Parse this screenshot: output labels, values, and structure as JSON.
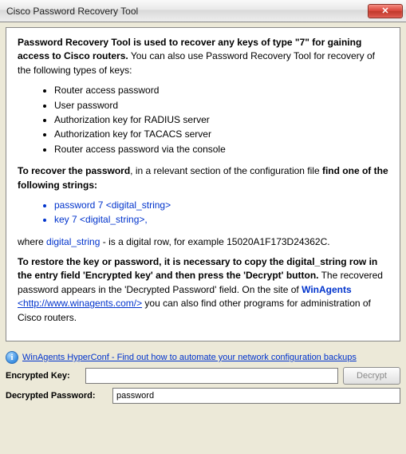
{
  "window": {
    "title": "Cisco Password Recovery Tool"
  },
  "info": {
    "intro_bold": "Password Recovery Tool is used to recover any keys of type \"7\" for gaining access to Cisco routers.",
    "intro_rest": " You can also use Password Recovery Tool for recovery of the following types of keys:",
    "keys": [
      "Router access password",
      "User password",
      "Authorization key for RADIUS server",
      "Authorization key for TACACS server",
      "Router access password via the console"
    ],
    "recover_a": "To recover the password",
    "recover_b": ", in a relevant section of the configuration file ",
    "recover_c": "find one of the following strings:",
    "strings": [
      "password 7 <digital_string>",
      "key 7 <digital_string>,"
    ],
    "where_a": "where ",
    "where_digital": "digital_string",
    "where_b": " - is a digital row, for example 15020A1F173D24362C.",
    "restore_a": "To restore the key or password, it is necessary to copy the digital_string row in the entry field 'Encrypted key' and then press the 'Decrypt' button.",
    "restore_b": " The recovered password appears in the 'Decrypted Password' field. On the site of ",
    "winagents_name": "WinAgents",
    "winagents_url": "<http://www.winagents.com/>",
    "restore_c": " you can also find other programs for administration of Cisco routers."
  },
  "hyperconf": {
    "text": "WinAgents HyperConf - Find out how to automate your network configuration backups"
  },
  "form": {
    "encrypted_label": "Encrypted Key:",
    "encrypted_value": "",
    "decrypt_label": "Decrypt",
    "decrypted_label": "Decrypted Password:",
    "decrypted_value": "password"
  }
}
